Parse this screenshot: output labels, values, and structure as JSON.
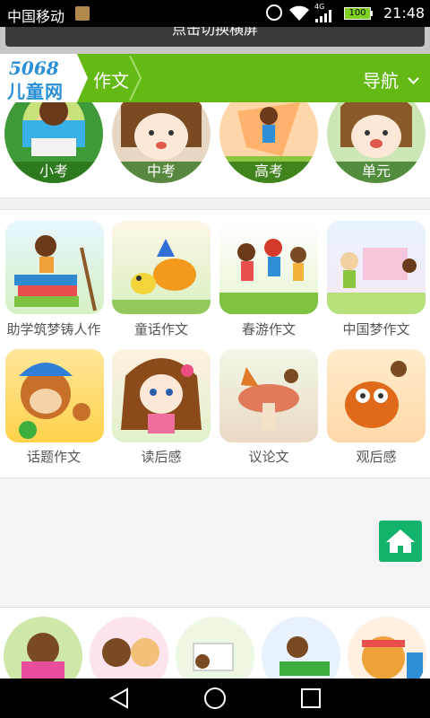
{
  "status_bar": {
    "carrier": "中国移动",
    "network": "4G",
    "battery": "100",
    "time": "21:48"
  },
  "rotate_banner": {
    "text": "点击切换横屏"
  },
  "header": {
    "logo_number": "5068",
    "logo_text": "儿童网",
    "breadcrumb": "作文",
    "nav_label": "导航"
  },
  "top_categories": [
    {
      "label": "小考"
    },
    {
      "label": "中考"
    },
    {
      "label": "高考"
    },
    {
      "label": "单元"
    }
  ],
  "grid_categories": [
    {
      "label": "助学筑梦铸人作"
    },
    {
      "label": "童话作文"
    },
    {
      "label": "春游作文"
    },
    {
      "label": "中国梦作文"
    },
    {
      "label": "话题作文"
    },
    {
      "label": "读后感"
    },
    {
      "label": "议论文"
    },
    {
      "label": "观后感"
    }
  ],
  "icons": {
    "home": "home-icon",
    "back": "back-icon",
    "home_nav": "circle-icon",
    "recent": "square-icon"
  },
  "colors": {
    "header_green": "#64b915",
    "home_button": "#13b36e"
  }
}
